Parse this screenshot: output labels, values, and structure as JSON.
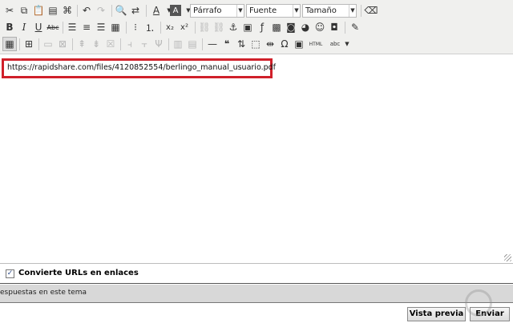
{
  "toolbar": {
    "format_select": "Párrafo",
    "font_select": "Fuente",
    "size_select": "Tamaño",
    "bold": "B",
    "italic": "I",
    "underline": "U",
    "strike": "Abc",
    "subscript": "x₂",
    "superscript": "x²",
    "omega": "Ω",
    "html": "HTML",
    "spell": "abc"
  },
  "editor": {
    "content": "https://rapidshare.com/files/4120852554/berlingo_manual_usuario.pdf"
  },
  "options": {
    "convert_urls_label": "Convierte URLs en enlaces",
    "convert_urls_checked": true
  },
  "thread_band": {
    "text": "espuestas en este tema"
  },
  "buttons": {
    "preview": "Vista previa",
    "send": "Enviar"
  },
  "colors": {
    "highlight_border": "#d0202a",
    "toolbar_bg": "#f0f0ee"
  }
}
